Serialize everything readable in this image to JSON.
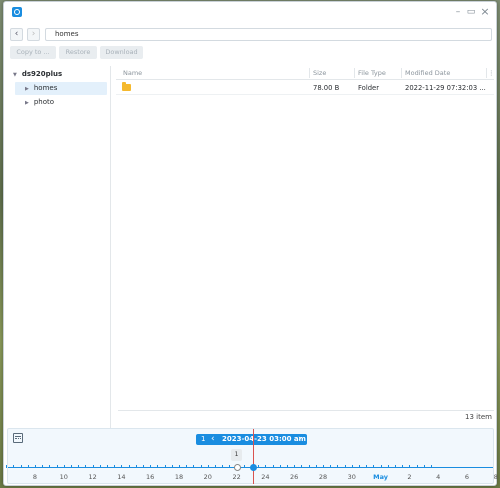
{
  "window": {
    "icon": "camera-icon",
    "controls": {
      "minimize": "–",
      "maximize": "▭",
      "close": "×"
    }
  },
  "toolbar": {
    "back_icon": "‹",
    "forward_icon": "›",
    "path": "homes",
    "copy_to_label": "Copy to ...",
    "restore_label": "Restore",
    "download_label": "Download"
  },
  "sidebar": {
    "root": "ds920plus",
    "items": [
      {
        "label": "homes",
        "selected": true
      },
      {
        "label": "photo",
        "selected": false
      }
    ]
  },
  "table": {
    "columns": [
      "Name",
      "Size",
      "File Type",
      "Modified Date"
    ],
    "rows": [
      {
        "name": "",
        "size": "78.00 B",
        "type": "Folder",
        "modified": "2022-11-29 07:32:03 ..."
      }
    ],
    "item_count": "13 item"
  },
  "timeline": {
    "selected_count": "1",
    "date": "2023-04-23 03:00 am",
    "prev_icon": "‹",
    "next_icon": "›",
    "snapshot_count": "1",
    "ticks": [
      "8",
      "10",
      "12",
      "14",
      "16",
      "18",
      "20",
      "22",
      "24",
      "26",
      "28",
      "30",
      "May",
      "2",
      "4",
      "6",
      "8"
    ]
  },
  "colors": {
    "accent": "#1a8de0",
    "cursor": "#d9534f",
    "folder": "#f5b92e"
  }
}
